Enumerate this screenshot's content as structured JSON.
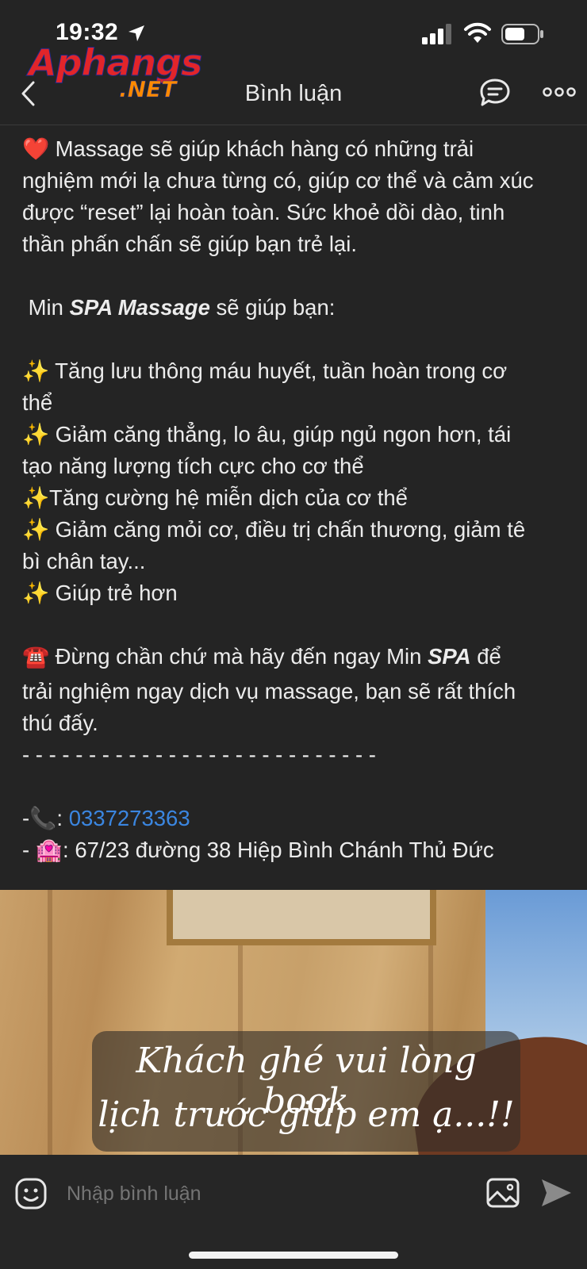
{
  "status_bar": {
    "time": "19:32"
  },
  "header": {
    "title": "Bình luận",
    "icons": [
      "back-chevron-icon",
      "comment-bubble-icon",
      "more-dots-icon"
    ]
  },
  "watermark": {
    "logo_top": "Aphangs",
    "logo_bottom": ".NET"
  },
  "post": {
    "para1": [
      {
        "emoji": "❤️",
        "text": "Massage sẽ giúp khách hàng có những trải"
      },
      {
        "text": "nghiệm mới lạ chưa từng có, giúp cơ thể và cảm xúc"
      },
      {
        "text": "được “reset” lại hoàn toàn. Sức khoẻ dồi dào, tinh"
      },
      {
        "text": "thần phấn chấn sẽ giúp bạn trẻ lại."
      }
    ],
    "intro_prefix": "Min",
    "intro_em": "SPA Massage",
    "intro_suffix": "sẽ giúp bạn:",
    "benefits": [
      {
        "emoji": "✨",
        "text": "Tăng lưu thông máu huyết, tuần hoàn trong cơ"
      },
      {
        "text": "thể"
      },
      {
        "emoji": "✨",
        "text": "Giảm căng thẳng, lo âu, giúp ngủ ngon hơn, tái"
      },
      {
        "text": "tạo năng lượng tích cực cho cơ thể"
      },
      {
        "emoji": "✨",
        "text": "Tăng cường hệ miễn dịch của cơ thể"
      },
      {
        "emoji": "✨",
        "text": "Giảm căng mỏi cơ, điều trị chấn thương, giảm tê"
      },
      {
        "text": "bì chân tay..."
      },
      {
        "emoji": "✨",
        "text": "Giúp trẻ hơn"
      }
    ],
    "cta_emoji": "☎️",
    "cta_prefix": "Đừng chần chứ mà hãy đến ngay Min",
    "cta_em": "SPA",
    "cta_suffix": "để",
    "cta_line2": "trải nghiệm ngay dịch vụ massage, bạn sẽ rất thích",
    "cta_line3": "thú đấy.",
    "divider": "- - - - - - - - - - - - - - - - - - - - - - - - - - -",
    "phone_prefix": "-📞:",
    "phone": "0337273363",
    "address_prefix": "- 🏩:",
    "address": "67/23 đường 38 Hiệp Bình Chánh Thủ Đức"
  },
  "image": {
    "caption_line1": "Khách ghé vui lòng book",
    "caption_line2": "lịch trước giúp em ạ...!!"
  },
  "composer": {
    "placeholder": "Nhập bình luận",
    "icons": [
      "emoji-icon",
      "image-icon",
      "send-icon"
    ]
  }
}
